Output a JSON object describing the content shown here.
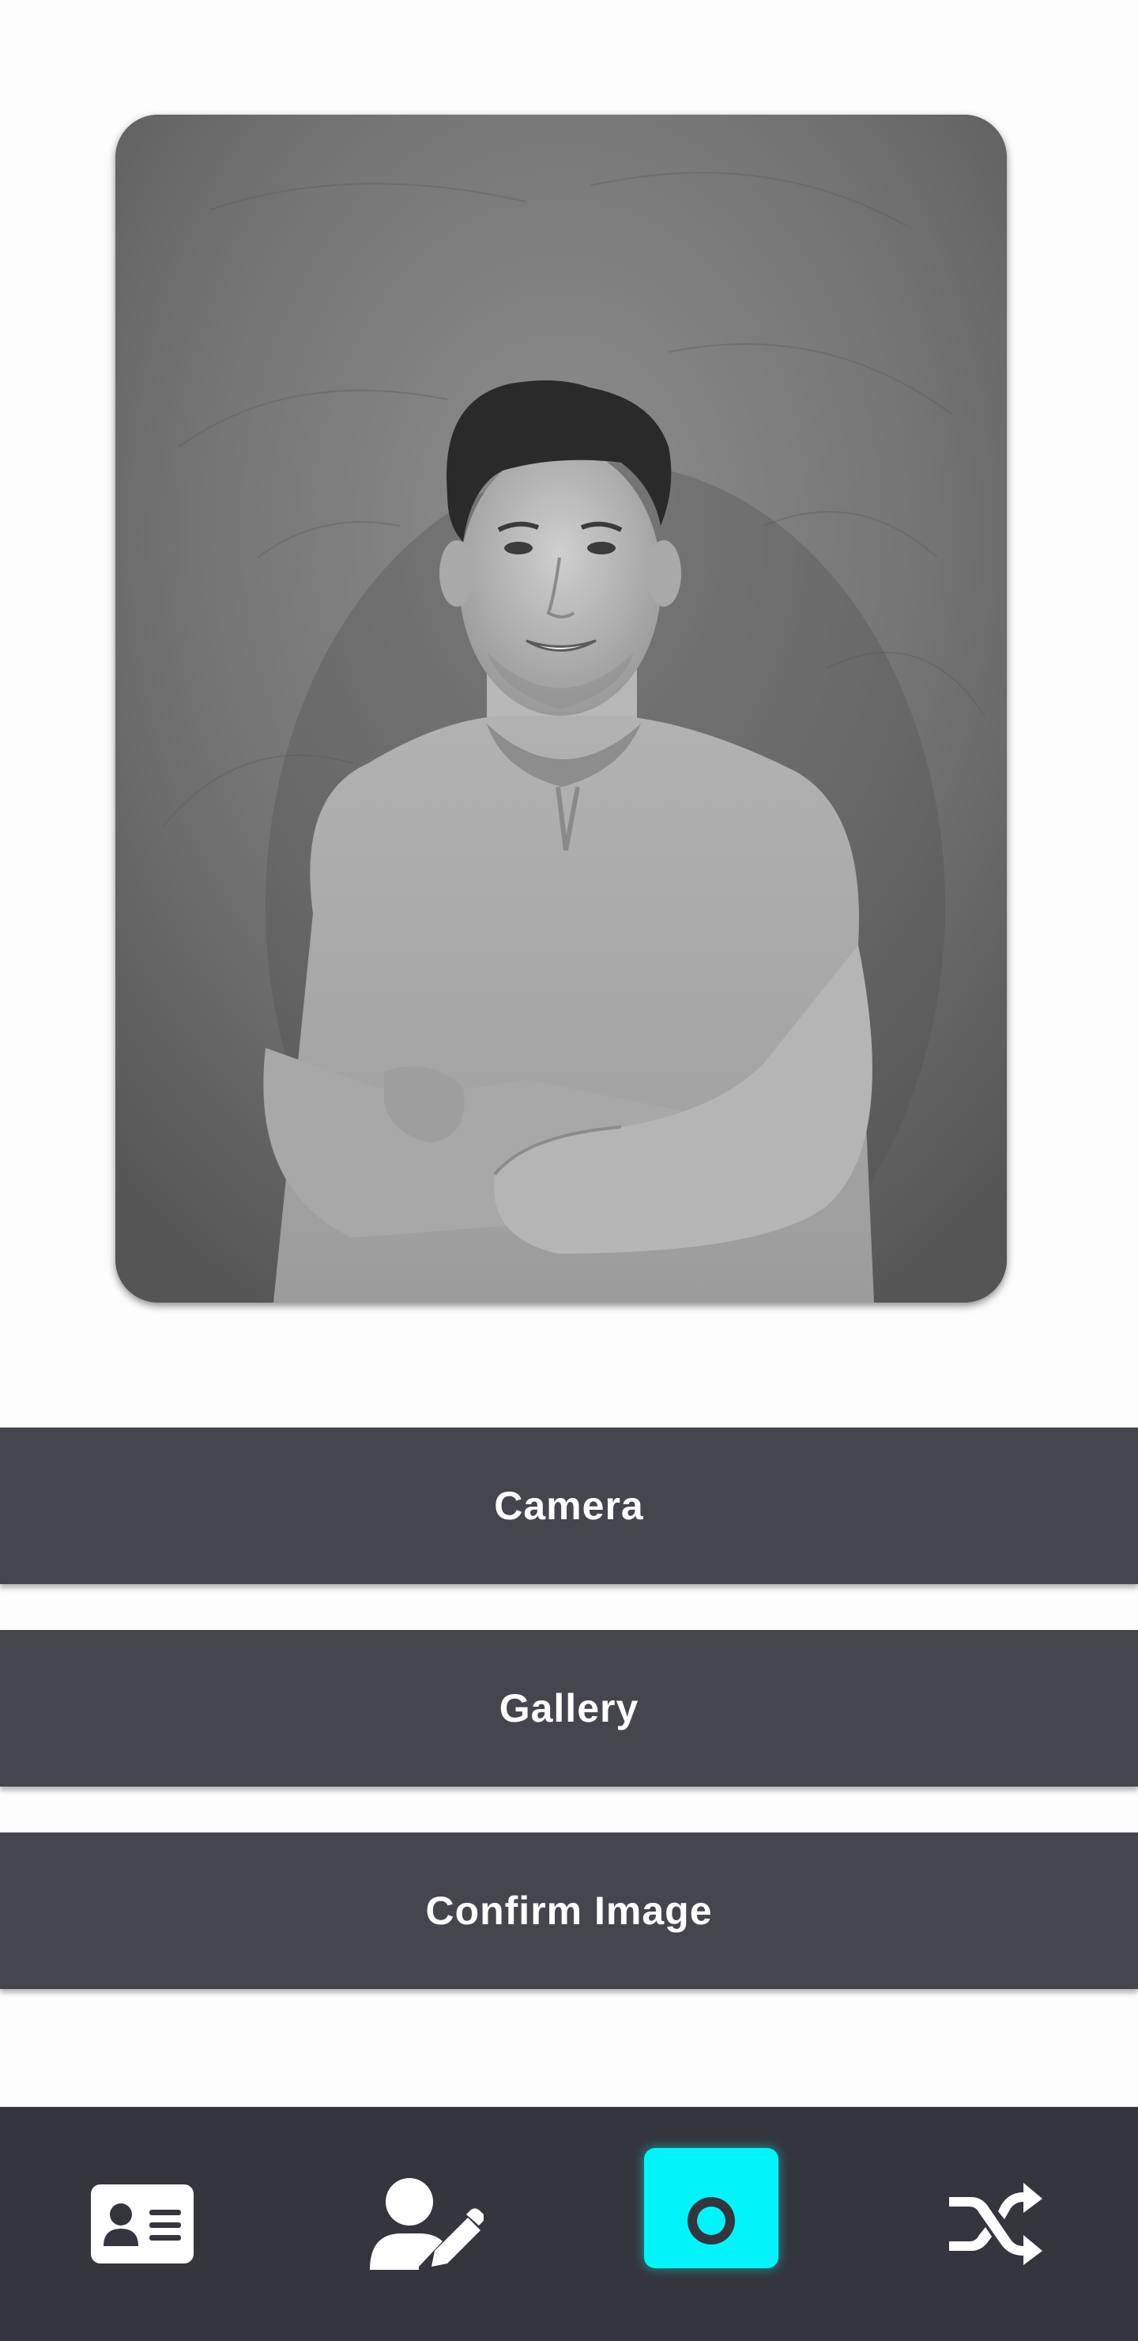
{
  "photo": {
    "description_icon": "person-portrait-photo"
  },
  "actions": {
    "camera_label": "Camera",
    "gallery_label": "Gallery",
    "confirm_label": "Confirm Image"
  },
  "bottom_nav": {
    "items": [
      {
        "icon": "id-card-icon",
        "active": false
      },
      {
        "icon": "user-edit-icon",
        "active": false
      },
      {
        "icon": "camera-icon",
        "active": true
      },
      {
        "icon": "shuffle-icon",
        "active": false
      }
    ]
  },
  "colors": {
    "button_bg": "#45454d",
    "nav_bg": "#35353d",
    "accent": "#00f5fb",
    "button_text": "#ffffff"
  }
}
